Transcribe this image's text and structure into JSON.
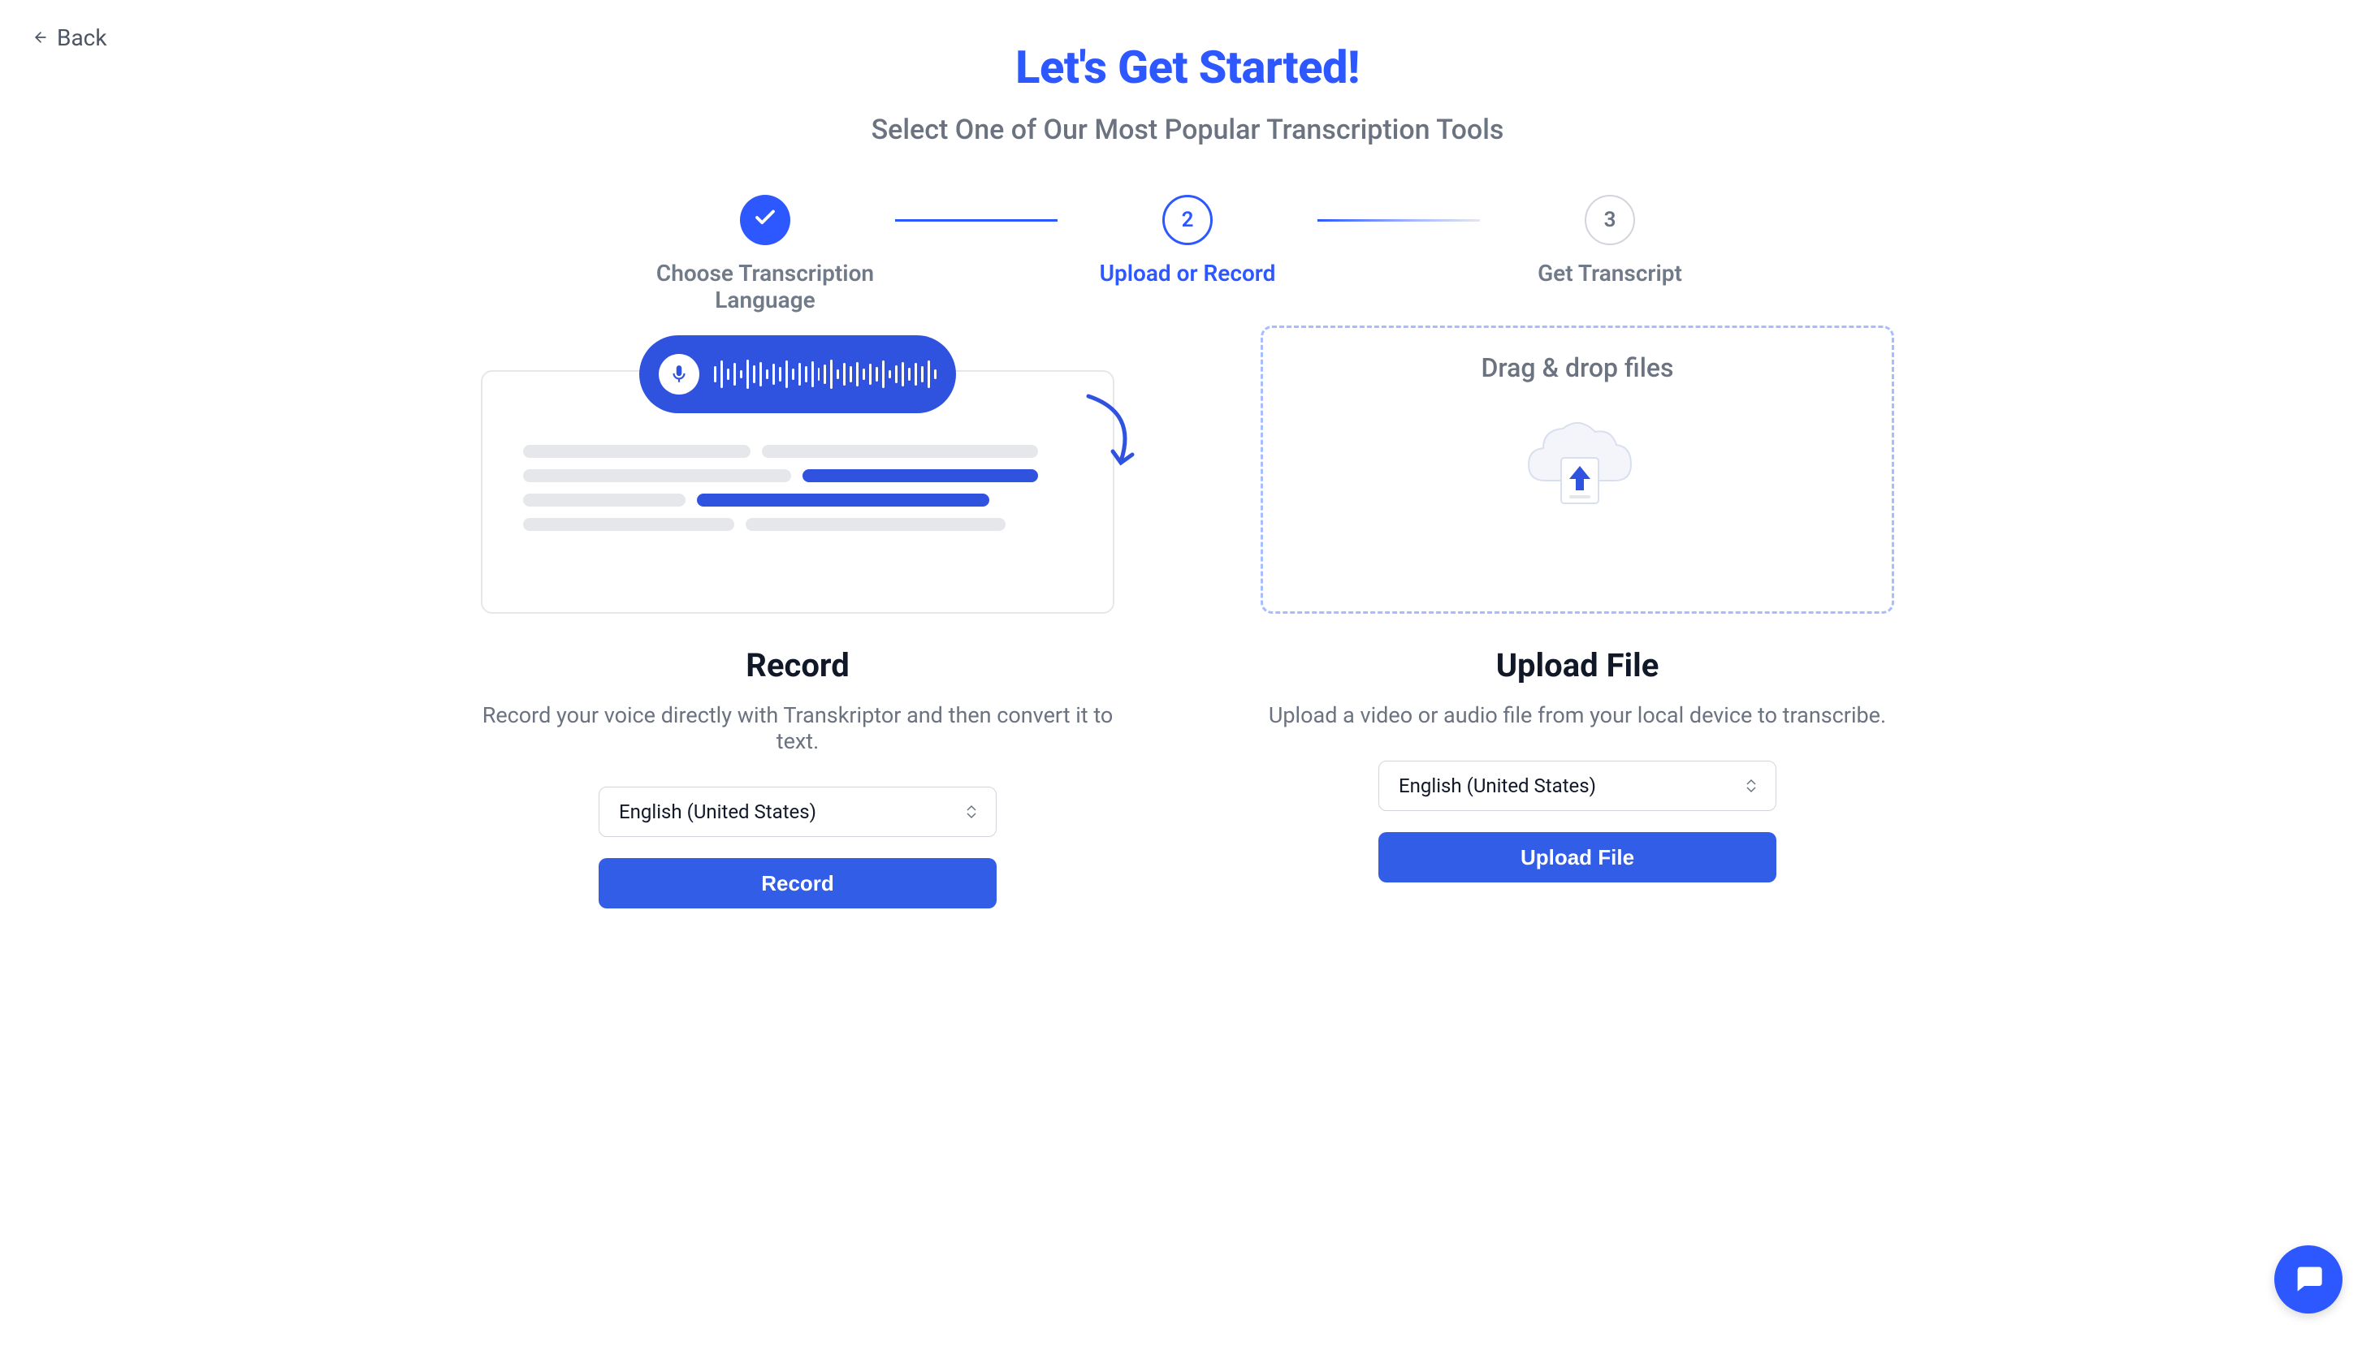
{
  "nav": {
    "back_label": "Back"
  },
  "header": {
    "title": "Let's Get Started!",
    "subtitle": "Select One of Our Most Popular Transcription Tools"
  },
  "stepper": {
    "step1": {
      "label": "Choose Transcription Language"
    },
    "step2": {
      "number": "2",
      "label": "Upload or Record"
    },
    "step3": {
      "number": "3",
      "label": "Get Transcript"
    }
  },
  "record": {
    "title": "Record",
    "description": "Record your voice directly with Transkriptor and then convert it to text.",
    "selected_language": "English (United States)",
    "button_label": "Record"
  },
  "upload": {
    "drop_label": "Drag & drop files",
    "title": "Upload File",
    "description": "Upload a video or audio file from your local device to transcribe.",
    "selected_language": "English (United States)",
    "button_label": "Upload File"
  }
}
